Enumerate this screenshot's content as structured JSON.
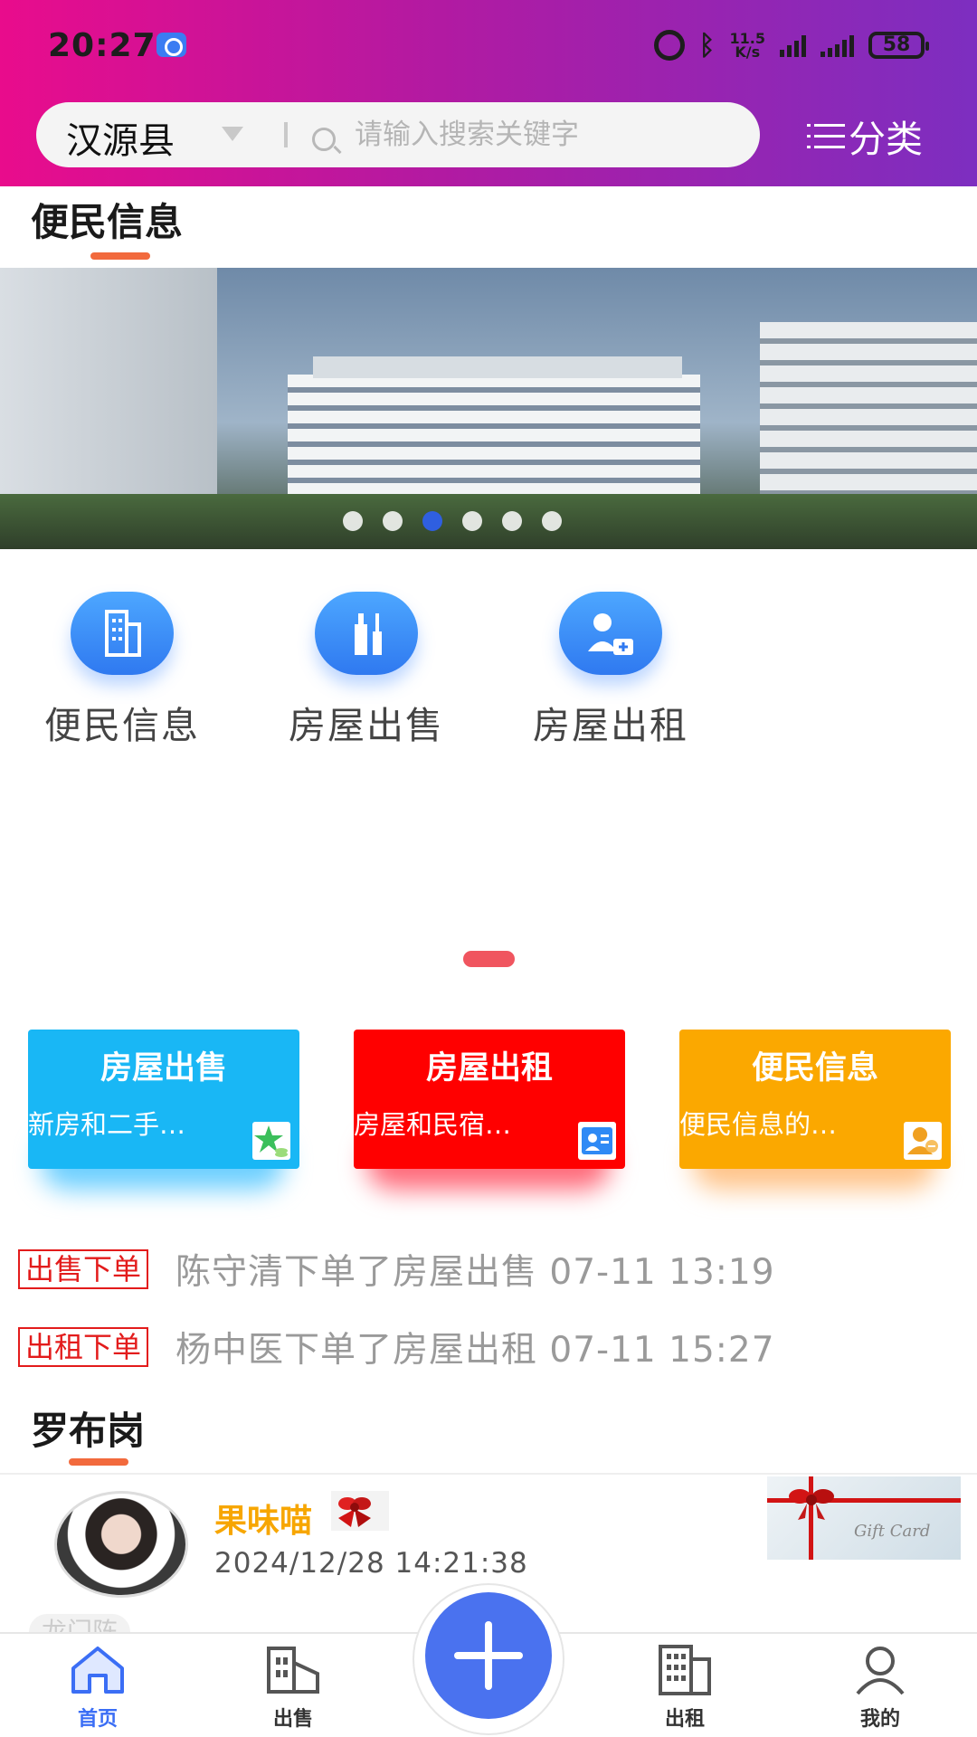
{
  "status_bar": {
    "time": "20:27",
    "net_speed_value": "11.5",
    "net_speed_unit": "K/s",
    "battery": "58"
  },
  "header": {
    "region": "汉源县",
    "search_placeholder": "请输入搜索关键字",
    "category_label": "分类"
  },
  "section_main": {
    "title": "便民信息"
  },
  "banner": {
    "slide_count": 6,
    "active_index": 2
  },
  "shortcuts": [
    {
      "label": "便民信息",
      "icon": "building-icon"
    },
    {
      "label": "房屋出售",
      "icon": "bottles-icon"
    },
    {
      "label": "房屋出租",
      "icon": "person-medkit-icon"
    }
  ],
  "cards": [
    {
      "title": "房屋出售",
      "desc": "新房和二手…",
      "color": "#19b7f5",
      "icon": "star-coins-icon"
    },
    {
      "title": "房屋出租",
      "desc": "房屋和民宿…",
      "color": "#ff0000",
      "icon": "id-card-icon"
    },
    {
      "title": "便民信息",
      "desc": "便民信息的…",
      "color": "#fba800",
      "icon": "person-chat-icon"
    }
  ],
  "notices": [
    {
      "tag": "出售下单",
      "text": "陈守清下单了房屋出售 07-11 13:19"
    },
    {
      "tag": "出租下单",
      "text": "杨中医下单了房屋出租 07-11 15:27"
    }
  ],
  "section_local": {
    "title": "罗布岗"
  },
  "post": {
    "author": "果味喵",
    "time": "2024/12/28 14:21:38",
    "gift_card_text": "Gift Card",
    "location_tag": "龙门阵"
  },
  "nav": {
    "home": "首页",
    "sell": "出售",
    "rent": "出租",
    "mine": "我的"
  }
}
